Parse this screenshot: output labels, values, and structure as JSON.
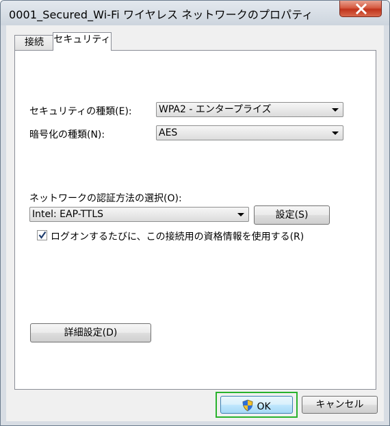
{
  "window": {
    "title": "0001_Secured_Wi-Fi ワイヤレス ネットワークのプロパティ",
    "close_label": "✕"
  },
  "tabs": [
    {
      "label": "接続",
      "selected": false
    },
    {
      "label": "セキュリティ",
      "selected": true
    }
  ],
  "security": {
    "type_label": "セキュリティの種類(E):",
    "type_value": "WPA2 - エンタープライズ",
    "encryption_label": "暗号化の種類(N):",
    "encryption_value": "AES",
    "auth_method_label": "ネットワークの認証方法の選択(O):",
    "auth_method_value": "Intel: EAP-TTLS",
    "settings_button": "設定(S)",
    "remember_checkbox_label": "ログオンするたびに、この接続用の資格情報を使用する(R)",
    "remember_checked": true,
    "advanced_button": "詳細設定(D)"
  },
  "footer": {
    "ok_label": "OK",
    "cancel_label": "キャンセル"
  },
  "colors": {
    "focus_border": "#28b22c",
    "close_button": "#c7432b"
  }
}
